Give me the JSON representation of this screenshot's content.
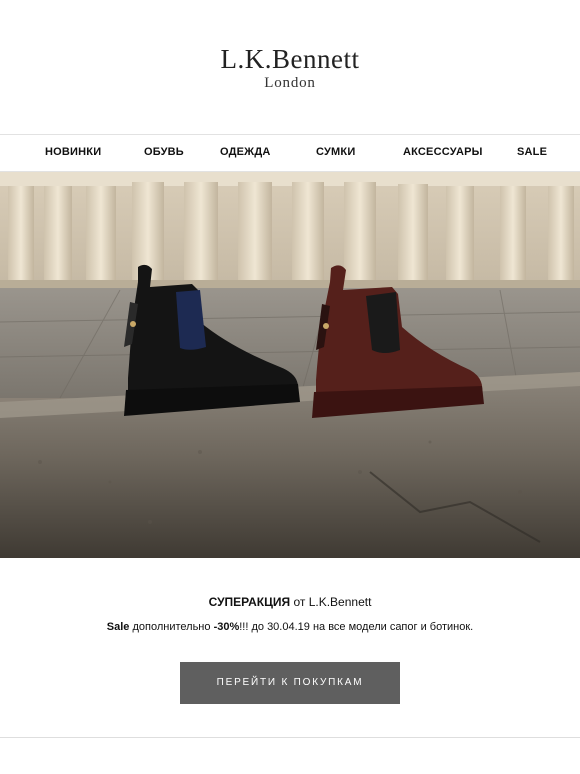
{
  "brand": {
    "name": "L.K.Bennett",
    "tagline": "London"
  },
  "nav": {
    "items": [
      {
        "label": "НОВИНКИ"
      },
      {
        "label": "ОБУВЬ"
      },
      {
        "label": "ОДЕЖДА"
      },
      {
        "label": "СУМКИ"
      },
      {
        "label": "АКСЕССУАРЫ"
      },
      {
        "label": "SALE"
      }
    ]
  },
  "hero": {
    "icon": "boots-photo"
  },
  "promo": {
    "title_bold": "СУПЕРАКЦИЯ",
    "title_rest": " от L.K.Bennett",
    "line_sale": "Sale",
    "line_mid": " дополнительно ",
    "line_discount": "-30%",
    "line_rest": "!!! до 30.04.19 на все модели сапог и ботинок."
  },
  "cta": {
    "label": "ПЕРЕЙТИ К ПОКУПКАМ"
  },
  "colors": {
    "button": "#5f5f5f",
    "divider": "#e2e2e2"
  }
}
